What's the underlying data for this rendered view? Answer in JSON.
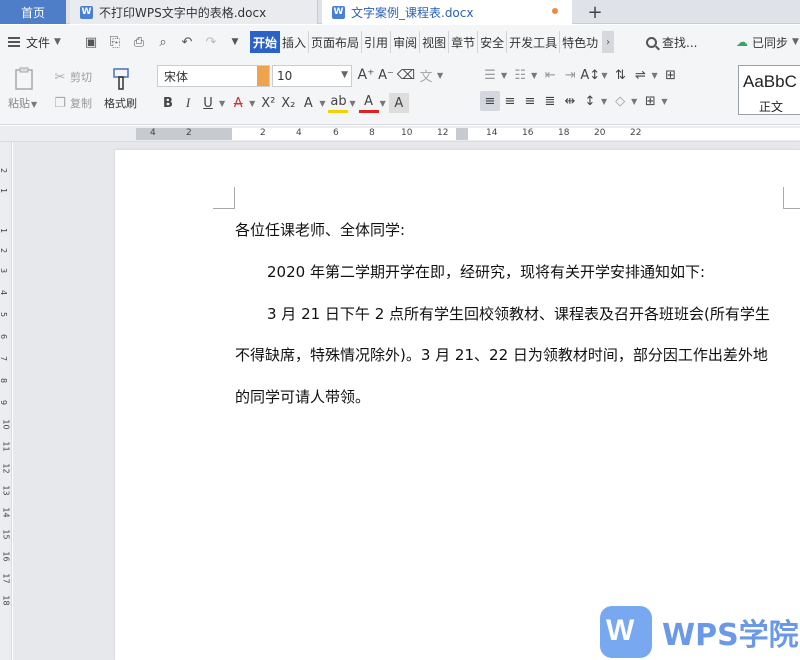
{
  "tabs": {
    "home": "首页",
    "doc1": "不打印WPS文字中的表格.docx",
    "doc2": "文字案例_课程表.docx",
    "add": "+"
  },
  "menubar": {
    "file": "文件",
    "tabs": [
      "开始",
      "插入",
      "页面布局",
      "引用",
      "审阅",
      "视图",
      "章节",
      "安全",
      "开发工具",
      "特色功"
    ],
    "active_tab": "开始",
    "search": "查找...",
    "sync": "已同步"
  },
  "ribbon": {
    "paste": "粘贴",
    "cut": "剪切",
    "copy": "复制",
    "format_painter": "格式刷",
    "font_name": "宋体",
    "font_size": "10",
    "style_sample": "AaBbC",
    "style_name": "正文"
  },
  "ruler": {
    "h_numbers": [
      "4",
      "2",
      "2",
      "4",
      "6",
      "8",
      "10",
      "12",
      "14",
      "16",
      "18",
      "20",
      "22"
    ],
    "v_numbers": [
      "2",
      "1",
      "1",
      "2",
      "3",
      "4",
      "5",
      "6",
      "7",
      "8",
      "9",
      "10",
      "11",
      "12",
      "13",
      "14",
      "15",
      "16",
      "17",
      "18"
    ]
  },
  "document": {
    "salutation": "各位任课老师、全体同学:",
    "intro": "2020 年第二学期开学在即，经研究，现将有关开学安排通知如下:",
    "body_line1": "3 月 21 日下午 2 点所有学生回校领教材、课程表及召开各班班会(所有学生",
    "body_line2": "不得缺席，特殊情况除外)。3 月 21、22 日为领教材时间，部分因工作出差外地",
    "body_line3": "的同学可请人带领。"
  },
  "watermark": {
    "logo_letter": "W",
    "text": "WPS学院"
  },
  "colors": {
    "accent": "#2b62c8",
    "home_tab": "#4f7ec9",
    "modified_dot": "#f08a3a",
    "watermark": "#5c8fe6"
  }
}
